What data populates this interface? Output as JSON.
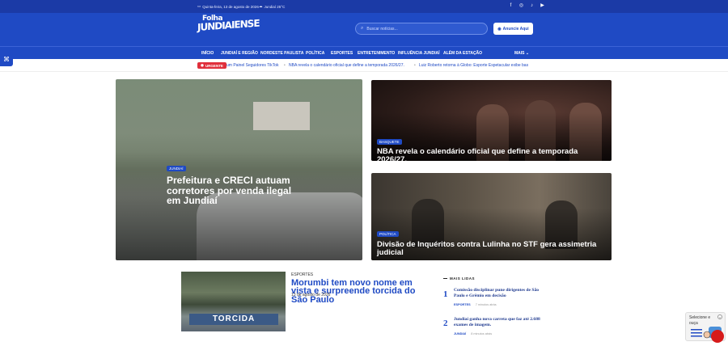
{
  "topbar": {
    "date": "Quinta-feira, 13 de agosto de 2026",
    "weather": "Jundiaí 25°C",
    "social": [
      "facebook-icon",
      "instagram-icon",
      "tiktok-icon",
      "youtube-icon"
    ]
  },
  "header": {
    "logo_line1": "Folha",
    "logo_line2": "JUNDIAIENSE",
    "search_placeholder": "Buscar notícias...",
    "anuncie_label": "Anuncie Aqui"
  },
  "nav": {
    "items": [
      "INÍCIO",
      "JUNDIAÍ E REGIÃO",
      "NORDESTE PAULISTA",
      "POLÍTICA",
      "ESPORTES",
      "ENTRETENIMENTO",
      "INFLUÊNCIA JUNDIAÍ",
      "ALÉM DA ESTAÇÃO"
    ],
    "more_label": "MAIS"
  },
  "ticker": {
    "badge": "URGENTE",
    "items": [
      "um Painel Seguidores TikTok",
      "NBA revela o calendário oficial que define a temporada 2026/27.",
      "Luiz Roberto retorna à Globo: Esporte Espetacular exibe bas"
    ]
  },
  "featured": {
    "main": {
      "category": "JUNDIAÍ",
      "title": "Prefeitura e CRECI autuam corretores por venda ilegal em Jundiaí"
    },
    "top_right": {
      "category": "BASQUETE",
      "title": "NBA revela o calendário oficial que define a temporada 2026/27."
    },
    "bottom_right": {
      "category": "POLÍTICA",
      "title": "Divisão de Inquéritos contra Lulinha no STF gera assimetria judicial"
    }
  },
  "secondary": {
    "category": "ESPORTES",
    "title": "Morumbi tem novo nome em vista e surpreende torcida do São Paulo",
    "date": "13 de agosto de 2026",
    "image_text": "TORCIDA"
  },
  "most_read": {
    "label": "MAIS LIDAS",
    "items": [
      {
        "rank": "1",
        "title": "Comissão disciplinar pune dirigentes de São Paulo e Grêmio em decisão",
        "category": "ESPORTES",
        "time": "7 minutos atrás"
      },
      {
        "rank": "2",
        "title": "Jundiaí ganha nova carreta que faz até 2.688 exames de imagem.",
        "category": "JUNDIAÍ",
        "time": "8 minutos atrás"
      }
    ]
  },
  "widget": {
    "text": "Selecione e ouça",
    "close": "×"
  }
}
